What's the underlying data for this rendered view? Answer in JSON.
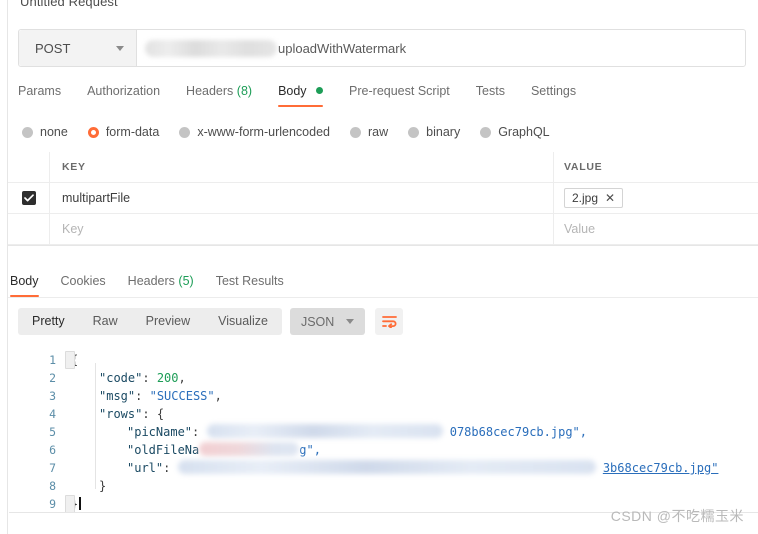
{
  "request": {
    "title": "Untitled Request",
    "method": "POST",
    "url_visible_suffix": "uploadWithWatermark",
    "tabs": [
      {
        "label": "Params",
        "active": false,
        "count": null,
        "dot": false
      },
      {
        "label": "Authorization",
        "active": false,
        "count": null,
        "dot": false
      },
      {
        "label": "Headers",
        "active": false,
        "count": "(8)",
        "dot": false
      },
      {
        "label": "Body",
        "active": true,
        "count": null,
        "dot": true
      },
      {
        "label": "Pre-request Script",
        "active": false,
        "count": null,
        "dot": false
      },
      {
        "label": "Tests",
        "active": false,
        "count": null,
        "dot": false
      },
      {
        "label": "Settings",
        "active": false,
        "count": null,
        "dot": false
      }
    ],
    "body_types": [
      {
        "label": "none",
        "selected": false
      },
      {
        "label": "form-data",
        "selected": true
      },
      {
        "label": "x-www-form-urlencoded",
        "selected": false
      },
      {
        "label": "raw",
        "selected": false
      },
      {
        "label": "binary",
        "selected": false
      },
      {
        "label": "GraphQL",
        "selected": false
      }
    ],
    "table": {
      "headers": {
        "key": "KEY",
        "value": "VALUE"
      },
      "rows": [
        {
          "checked": true,
          "key": "multipartFile",
          "value_file": "2.jpg",
          "remove_label": "✕"
        }
      ],
      "new_row": {
        "key_placeholder": "Key",
        "value_placeholder": "Value"
      }
    }
  },
  "response": {
    "tabs": [
      {
        "label": "Body",
        "active": true,
        "count": null
      },
      {
        "label": "Cookies",
        "active": false,
        "count": null
      },
      {
        "label": "Headers",
        "active": false,
        "count": "(5)"
      },
      {
        "label": "Test Results",
        "active": false,
        "count": null
      }
    ],
    "viewer_modes": [
      {
        "label": "Pretty",
        "active": true
      },
      {
        "label": "Raw",
        "active": false
      },
      {
        "label": "Preview",
        "active": false
      },
      {
        "label": "Visualize",
        "active": false
      }
    ],
    "format": "JSON",
    "wrap_icon": "text-wrap-icon",
    "line_numbers": [
      "1",
      "2",
      "3",
      "4",
      "5",
      "6",
      "7",
      "8",
      "9"
    ],
    "code_lines": [
      {
        "n": "1",
        "text": "{"
      },
      {
        "n": "2",
        "text": "    \"code\": 200,"
      },
      {
        "n": "3",
        "text": "    \"msg\": \"SUCCESS\","
      },
      {
        "n": "4",
        "text": "    \"rows\": {"
      },
      {
        "n": "5",
        "text": "        \"picName\": \"[redacted]078b68cec79cb.jpg\","
      },
      {
        "n": "6",
        "text": "        \"oldFileName\": \"[redacted]g\","
      },
      {
        "n": "7",
        "text": "        \"url\": \"[redacted]3b68cec79cb.jpg\""
      },
      {
        "n": "8",
        "text": "    }"
      },
      {
        "n": "9",
        "text": "}"
      }
    ],
    "code_fragments": {
      "key_code": "\"code\"",
      "val_code": "200",
      "key_msg": "\"msg\"",
      "val_msg": "\"SUCCESS\"",
      "key_rows": "\"rows\"",
      "key_picname": "\"picName\"",
      "val_picname_tail": "078b68cec79cb.jpg\",",
      "key_oldfilename_head": "\"oldFileNa",
      "val_oldfilename_tail": "g\",",
      "key_url": "\"url\"",
      "val_url_tail": "3b68cec79cb.jpg\"",
      "brace_open": "{",
      "brace_close": "}",
      "brace_close_inner": "}",
      "colon": ":",
      "comma": ","
    }
  },
  "watermark": "CSDN @不吃糯玉米",
  "colors": {
    "accent": "#ff6c37",
    "green": "#1d9d57",
    "json_string": "#2a6ebb",
    "json_key": "#1b4a63",
    "gutter": "#5c8ea8"
  }
}
